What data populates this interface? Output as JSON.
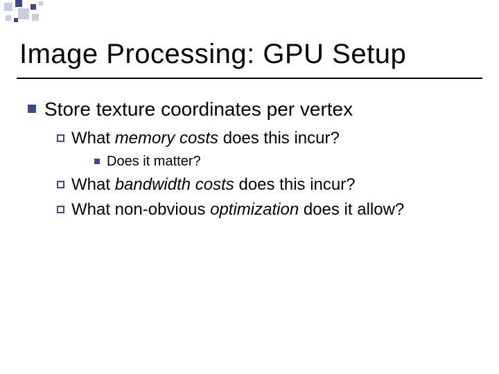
{
  "title": "Image Processing:  GPU Setup",
  "bullets": {
    "l1": "Store texture coordinates per vertex",
    "l2a_pre": "What ",
    "l2a_em": "memory costs",
    "l2a_post": " does this incur?",
    "l3": "Does it matter?",
    "l2b_pre": "What ",
    "l2b_em": "bandwidth costs",
    "l2b_post": " does this incur?",
    "l2c_pre": "What non-obvious ",
    "l2c_em": "optimization",
    "l2c_post": " does it allow?"
  }
}
